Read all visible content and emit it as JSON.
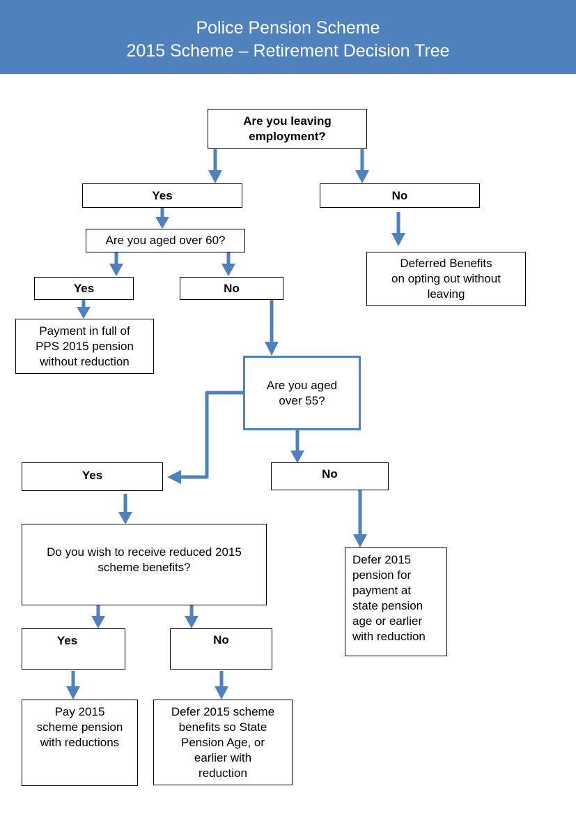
{
  "header": {
    "title_line1": "Police Pension Scheme",
    "title_line2": "2015 Scheme – Retirement Decision Tree",
    "background_color": "#4f81bd",
    "text_color": "#ffffff"
  },
  "colors": {
    "arrow": "#4f81bd",
    "box_border": "#000000",
    "highlight_box_border": "#4f81bd"
  },
  "nodes": {
    "leaving_employment": {
      "text": "Are you leaving employment?"
    },
    "leaving_yes": {
      "text": "Yes"
    },
    "leaving_no": {
      "text": "No"
    },
    "aged_over_60": {
      "text": "Are you aged over 60?"
    },
    "over60_yes": {
      "text": "Yes"
    },
    "over60_no": {
      "text": "No"
    },
    "payment_in_full": {
      "line1": "Payment in full of",
      "line2": "PPS 2015 pension",
      "line3": "without reduction"
    },
    "deferred_benefits": {
      "line1": "Deferred Benefits",
      "line2": "on opting out without",
      "line3": "leaving"
    },
    "aged_over_55": {
      "line1": "Are you aged",
      "line2": "over 55?"
    },
    "over55_yes": {
      "text": "Yes"
    },
    "over55_no": {
      "text": "No"
    },
    "reduced_benefits": {
      "line1": "Do you wish to receive reduced 2015",
      "line2": "scheme benefits?"
    },
    "defer_state_pension": {
      "line1": "Defer 2015",
      "line2": "pension for",
      "line3": "payment at",
      "line4": "state pension",
      "line5": "age or earlier",
      "line6": "with reduction"
    },
    "reduced_yes": {
      "text": "Yes"
    },
    "reduced_no": {
      "text": "No"
    },
    "pay_with_reductions": {
      "line1": "Pay 2015",
      "line2": "scheme pension",
      "line3": "with reductions"
    },
    "defer_scheme_benefits": {
      "line1": "Defer 2015 scheme",
      "line2": "benefits so State",
      "line3": "Pension Age, or",
      "line4": "earlier with",
      "line5": "reduction"
    }
  }
}
